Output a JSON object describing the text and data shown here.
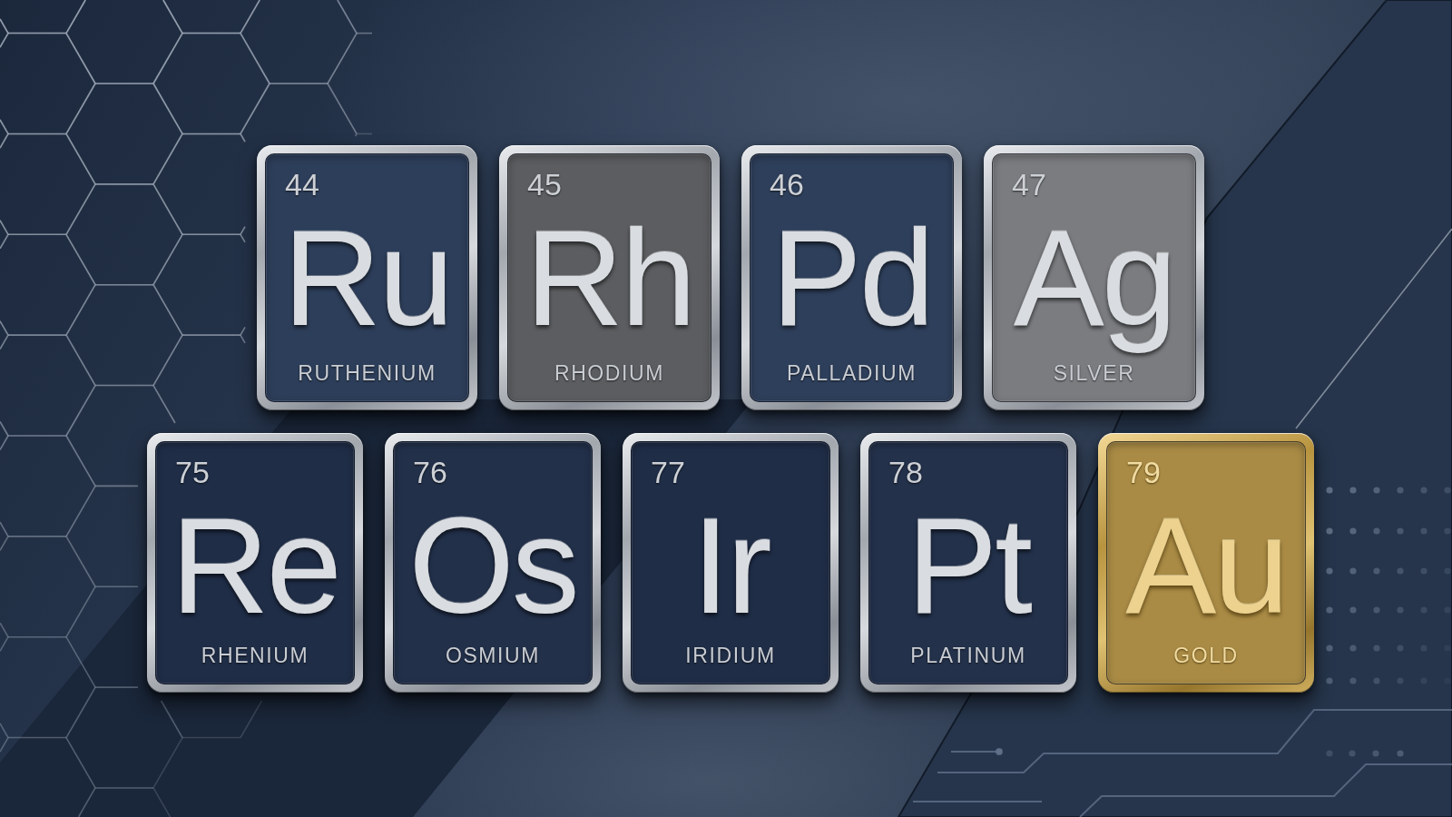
{
  "tile_rows": [
    {
      "tiles": [
        {
          "number": "44",
          "symbol": "Ru",
          "name": "RUTHENIUM",
          "kind": "silver",
          "color": "#2d3e5a"
        },
        {
          "number": "45",
          "symbol": "Rh",
          "name": "RHODIUM",
          "kind": "silver",
          "color": "#5b5d60"
        },
        {
          "number": "46",
          "symbol": "Pd",
          "name": "PALLADIUM",
          "kind": "silver",
          "color": "#2e3f5b"
        },
        {
          "number": "47",
          "symbol": "Ag",
          "name": "SILVER",
          "kind": "silver",
          "color": "#7a7c7f"
        }
      ]
    },
    {
      "tiles": [
        {
          "number": "75",
          "symbol": "Re",
          "name": "RHENIUM",
          "kind": "silver",
          "color": "#1f2d47"
        },
        {
          "number": "76",
          "symbol": "Os",
          "name": "OSMIUM",
          "kind": "silver",
          "color": "#22304a"
        },
        {
          "number": "77",
          "symbol": "Ir",
          "name": "IRIDIUM",
          "kind": "silver",
          "color": "#1f2d47"
        },
        {
          "number": "78",
          "symbol": "Pt",
          "name": "PLATINUM",
          "kind": "silver",
          "color": "#23314b"
        },
        {
          "number": "79",
          "symbol": "Au",
          "name": "GOLD",
          "kind": "gold",
          "color": "#a98b45"
        }
      ]
    }
  ]
}
